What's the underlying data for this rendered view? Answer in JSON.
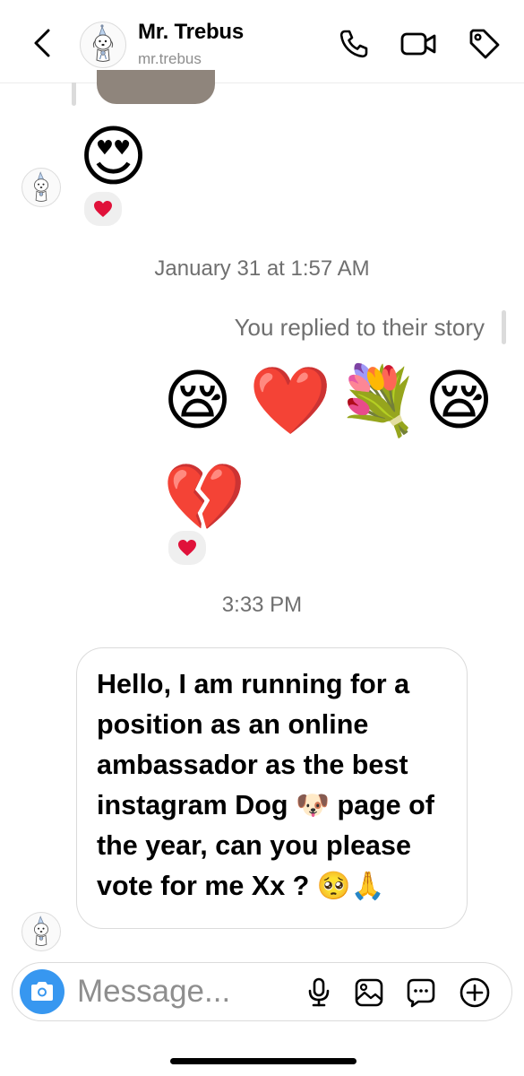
{
  "header": {
    "name": "Mr. Trebus",
    "username": "mr.trebus",
    "icons": [
      "back-chevron-icon",
      "phone-icon",
      "video-camera-icon",
      "tag-icon"
    ]
  },
  "messages": {
    "received_emoji_1": "😍",
    "received_emoji_1_reaction": "❤️",
    "timestamp_1": "January 31 at 1:57 AM",
    "replied_label": "You replied to their story",
    "sent_emojis": [
      "😪",
      "❤️",
      "💐",
      "😪"
    ],
    "sent_emoji_2": "💔",
    "sent_emoji_2_reaction": "❤️",
    "timestamp_2": "3:33 PM",
    "received_text": "Hello, I am running for a position as an online ambassador as the best instagram Dog 🐶 page of the year, can you please vote for me Xx ? 🥺🙏"
  },
  "composer": {
    "placeholder": "Message...",
    "icons": [
      "camera-icon",
      "microphone-icon",
      "gallery-icon",
      "sticker-icon",
      "plus-icon"
    ]
  },
  "colors": {
    "accent": "#3797f0",
    "secondary_text": "#8e8e8e",
    "border": "#dbdbdb",
    "reaction_bg": "#efefef"
  }
}
